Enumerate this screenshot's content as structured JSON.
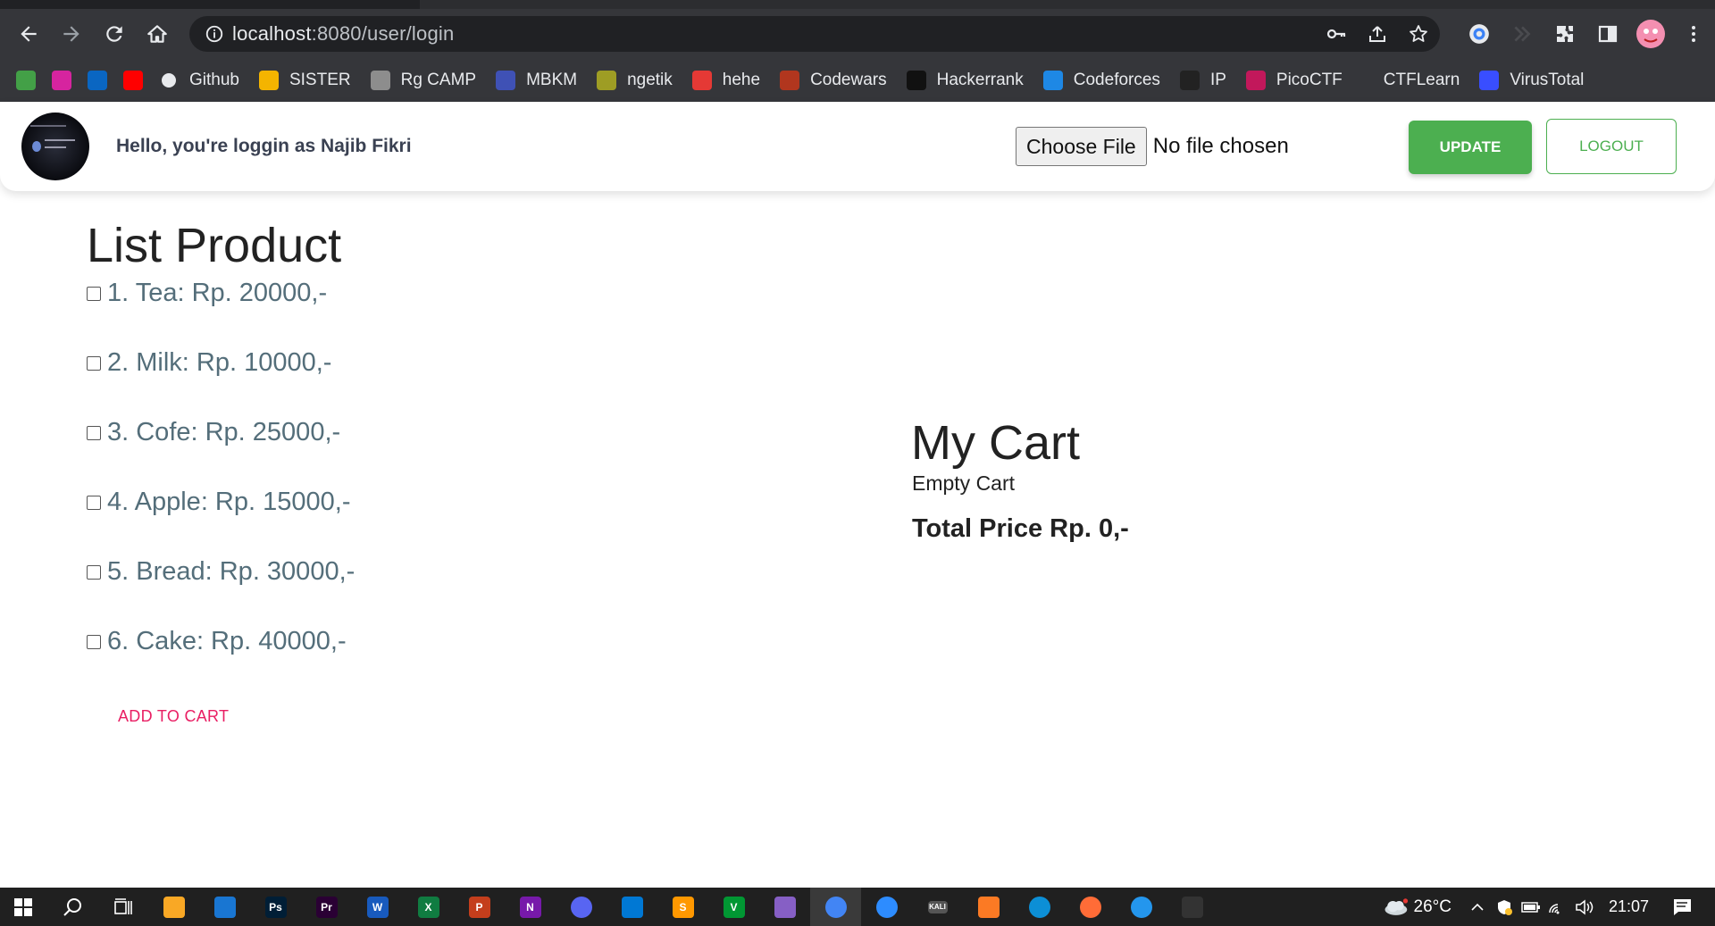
{
  "browser": {
    "url_host": "localhost",
    "url_path": ":8080/user/login",
    "bookmarks": [
      {
        "label": "",
        "icon": "92-badge-icon",
        "color": "#43a047"
      },
      {
        "label": "",
        "icon": "instagram-icon",
        "color": "#d6249f"
      },
      {
        "label": "",
        "icon": "linkedin-icon",
        "color": "#0a66c2"
      },
      {
        "label": "",
        "icon": "youtube-icon",
        "color": "#ff0000"
      },
      {
        "label": "Github",
        "icon": "github-icon",
        "color": "#ffffff"
      },
      {
        "label": "SISTER",
        "icon": "sister-icon",
        "color": "#f4b400"
      },
      {
        "label": "Rg CAMP",
        "icon": "rgcamp-icon",
        "color": "#8d8d8d"
      },
      {
        "label": "MBKM",
        "icon": "mbkm-icon",
        "color": "#3f51b5"
      },
      {
        "label": "ngetik",
        "icon": "ngetik-icon",
        "color": "#9e9d24"
      },
      {
        "label": "hehe",
        "icon": "video-icon",
        "color": "#e53935"
      },
      {
        "label": "Codewars",
        "icon": "codewars-icon",
        "color": "#b1361e"
      },
      {
        "label": "Hackerrank",
        "icon": "hackerrank-icon",
        "color": "#111111"
      },
      {
        "label": "Codeforces",
        "icon": "codeforces-icon",
        "color": "#1e88e5"
      },
      {
        "label": "IP",
        "icon": "globe-icon",
        "color": "#222222"
      },
      {
        "label": "PicoCTF",
        "icon": "picoctf-icon",
        "color": "#c2185b"
      },
      {
        "label": "CTFLearn",
        "icon": "",
        "color": ""
      },
      {
        "label": "VirusTotal",
        "icon": "virustotal-icon",
        "color": "#394eff"
      }
    ]
  },
  "header": {
    "greeting": "Hello, you're loggin as Najib Fikri",
    "choose_file": "Choose File",
    "no_file": "No file chosen",
    "update": "UPDATE",
    "logout": "LOGOUT"
  },
  "products": {
    "title": "List Product",
    "items": [
      {
        "label": "1. Tea: Rp. 20000,-",
        "checked": false
      },
      {
        "label": "2. Milk: Rp. 10000,-",
        "checked": false
      },
      {
        "label": "3. Cofe: Rp. 25000,-",
        "checked": false
      },
      {
        "label": "4. Apple: Rp. 15000,-",
        "checked": false
      },
      {
        "label": "5. Bread: Rp. 30000,-",
        "checked": false
      },
      {
        "label": "6. Cake: Rp. 40000,-",
        "checked": false
      }
    ],
    "add_to_cart": "ADD TO CART"
  },
  "cart": {
    "title": "My Cart",
    "status": "Empty Cart",
    "total": "Total Price Rp. 0,-"
  },
  "taskbar": {
    "apps": [
      {
        "icon": "file-explorer-icon",
        "text": "",
        "color": "#f9a825"
      },
      {
        "icon": "mail-icon",
        "text": "",
        "color": "#1976d2"
      },
      {
        "icon": "photoshop-icon",
        "text": "Ps",
        "color": "#001e36"
      },
      {
        "icon": "premiere-icon",
        "text": "Pr",
        "color": "#2a0034"
      },
      {
        "icon": "word-icon",
        "text": "W",
        "color": "#185abd"
      },
      {
        "icon": "excel-icon",
        "text": "X",
        "color": "#107c41"
      },
      {
        "icon": "powerpoint-icon",
        "text": "P",
        "color": "#c43e1c"
      },
      {
        "icon": "onenote-icon",
        "text": "N",
        "color": "#7719aa"
      },
      {
        "icon": "discord-icon",
        "text": "",
        "color": "#5865f2"
      },
      {
        "icon": "vscode-icon",
        "text": "",
        "color": "#0078d4"
      },
      {
        "icon": "sublime-icon",
        "text": "S",
        "color": "#ff9800"
      },
      {
        "icon": "vim-icon",
        "text": "V",
        "color": "#019733"
      },
      {
        "icon": "visual-studio-icon",
        "text": "",
        "color": "#865fc5"
      },
      {
        "icon": "chrome-icon",
        "text": "",
        "color": "#4285f4"
      },
      {
        "icon": "zoom-icon",
        "text": "",
        "color": "#2d8cff"
      },
      {
        "icon": "kali-icon",
        "text": "KALI",
        "color": "#555555"
      },
      {
        "icon": "xampp-icon",
        "text": "",
        "color": "#fb7a24"
      },
      {
        "icon": "edge-icon",
        "text": "",
        "color": "#0c8fd6"
      },
      {
        "icon": "postman-icon",
        "text": "",
        "color": "#ff6c37"
      },
      {
        "icon": "docker-icon",
        "text": "",
        "color": "#2496ed"
      },
      {
        "icon": "terminal-icon",
        "text": "",
        "color": "#333333"
      }
    ],
    "temperature": "26°C",
    "time": "21:07"
  }
}
